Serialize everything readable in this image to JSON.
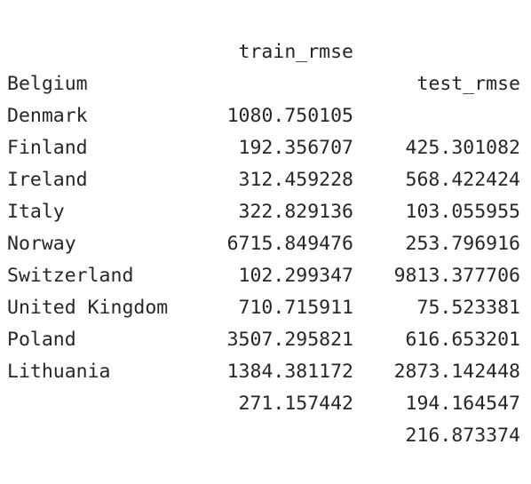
{
  "table": {
    "columns": [
      "train_rmse",
      "test_rmse"
    ],
    "rows": [
      {
        "index": "Belgium",
        "train_rmse": "1080.750105",
        "test_rmse": "425.301082"
      },
      {
        "index": "Denmark",
        "train_rmse": "192.356707",
        "test_rmse": "568.422424"
      },
      {
        "index": "Finland",
        "train_rmse": "312.459228",
        "test_rmse": "103.055955"
      },
      {
        "index": "Ireland",
        "train_rmse": "322.829136",
        "test_rmse": "253.796916"
      },
      {
        "index": "Italy",
        "train_rmse": "6715.849476",
        "test_rmse": "9813.377706"
      },
      {
        "index": "Norway",
        "train_rmse": "102.299347",
        "test_rmse": "75.523381"
      },
      {
        "index": "Switzerland",
        "train_rmse": "710.715911",
        "test_rmse": "616.653201"
      },
      {
        "index": "United Kingdom",
        "train_rmse": "3507.295821",
        "test_rmse": "2873.142448"
      },
      {
        "index": "Poland",
        "train_rmse": "1384.381172",
        "test_rmse": "194.164547"
      },
      {
        "index": "Lithuania",
        "train_rmse": "271.157442",
        "test_rmse": "216.873374"
      }
    ]
  }
}
